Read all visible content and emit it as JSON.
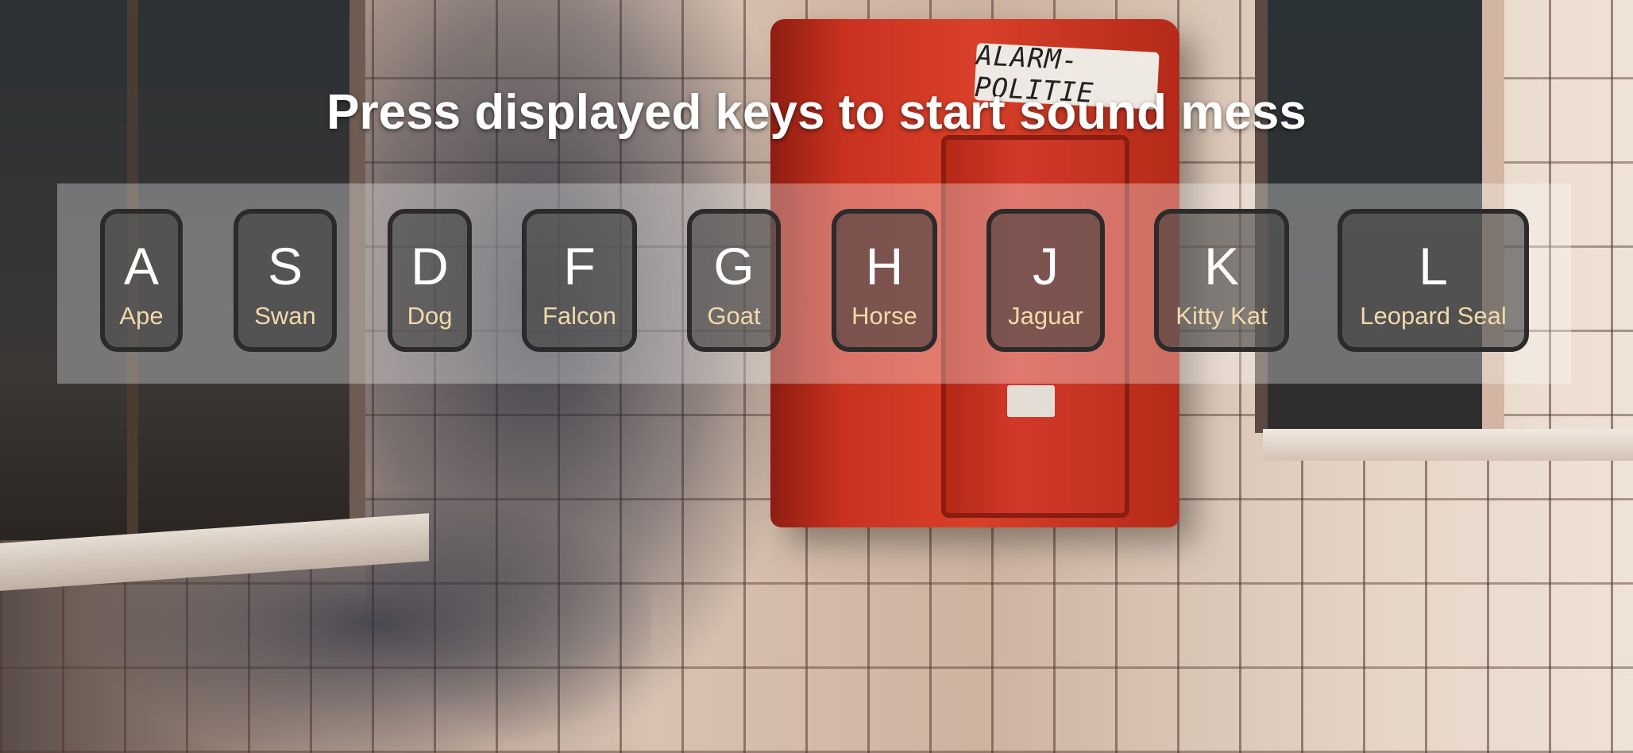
{
  "sign": {
    "plate_text": "ALARM-POLITIE"
  },
  "header": {
    "title": "Press displayed keys to start sound mess"
  },
  "keys": [
    {
      "letter": "A",
      "sound": "Ape"
    },
    {
      "letter": "S",
      "sound": "Swan"
    },
    {
      "letter": "D",
      "sound": "Dog"
    },
    {
      "letter": "F",
      "sound": "Falcon"
    },
    {
      "letter": "G",
      "sound": "Goat"
    },
    {
      "letter": "H",
      "sound": "Horse"
    },
    {
      "letter": "J",
      "sound": "Jaguar"
    },
    {
      "letter": "K",
      "sound": "Kitty Kat"
    },
    {
      "letter": "L",
      "sound": "Leopard Seal"
    }
  ]
}
